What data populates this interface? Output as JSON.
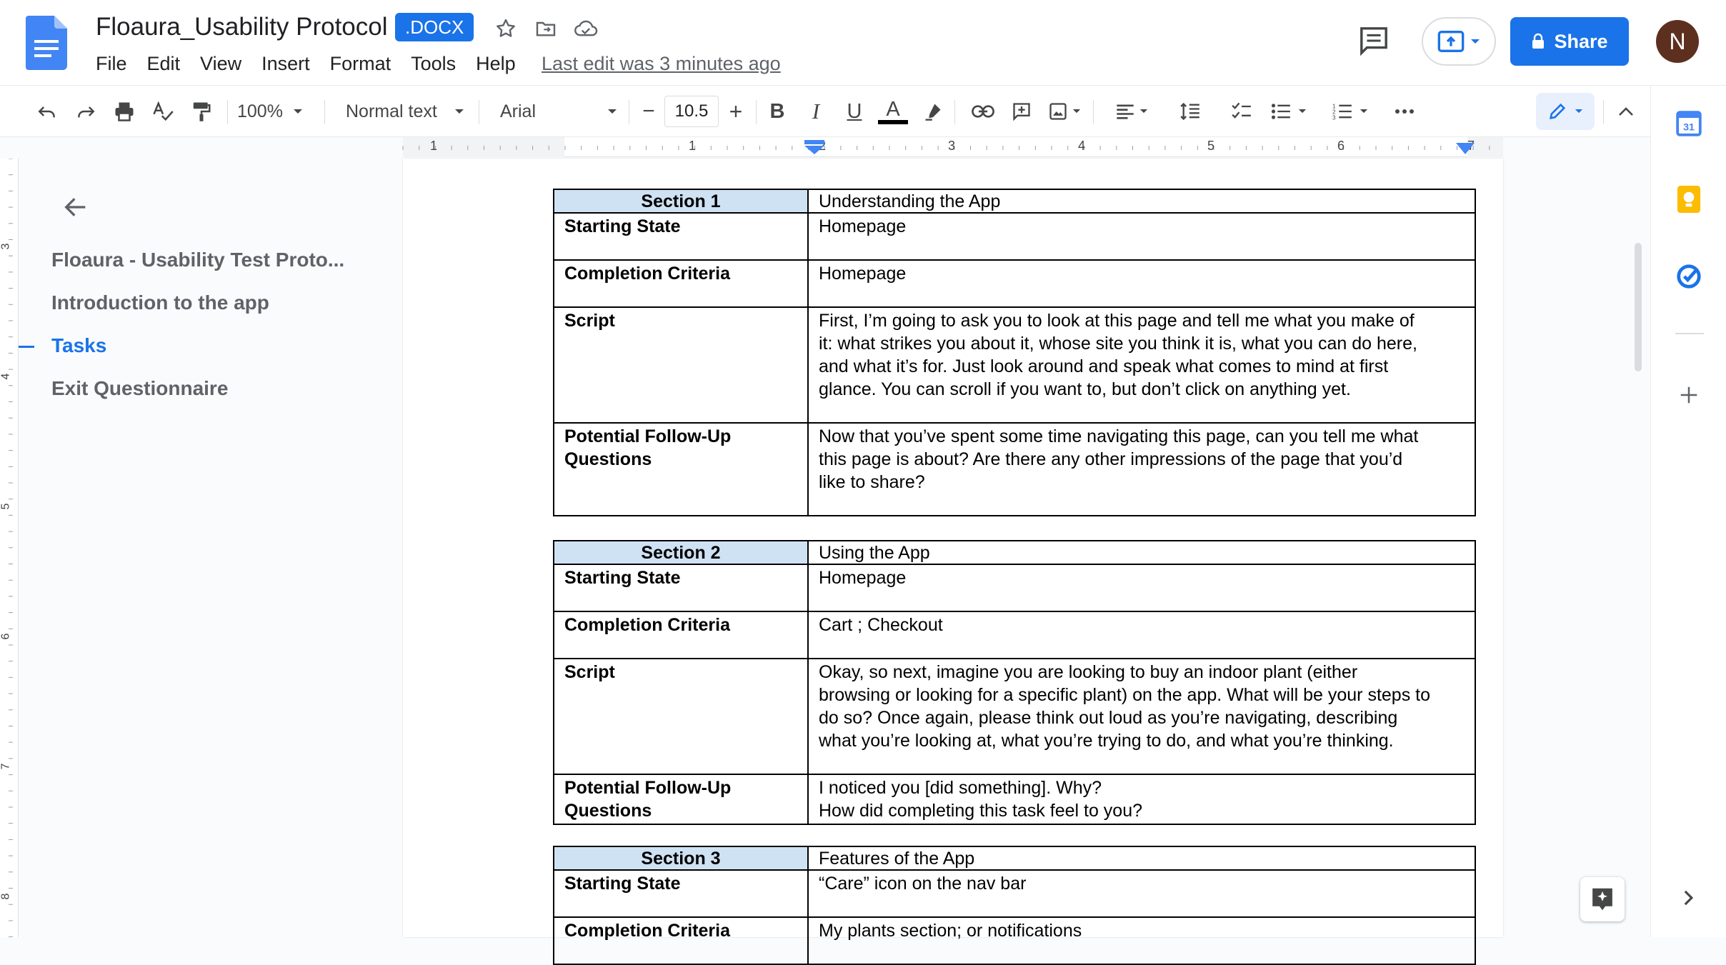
{
  "app": {
    "title": "Floaura_Usability Protocol",
    "badge": ".DOCX",
    "last_edit": "Last edit was 3 minutes ago",
    "share_label": "Share",
    "avatar_letter": "N",
    "accent_color": "#1a73e8"
  },
  "menu": [
    "File",
    "Edit",
    "View",
    "Insert",
    "Format",
    "Tools",
    "Help"
  ],
  "toolbar": {
    "zoom": "100%",
    "style": "Normal text",
    "font": "Arial",
    "font_size": "10.5",
    "bold": "B",
    "italic": "I",
    "underline": "U",
    "text_color": "A",
    "minus": "−",
    "plus": "+"
  },
  "ruler": {
    "h_numbers": [
      "1",
      "1",
      "2",
      "3",
      "4",
      "5",
      "6",
      "7"
    ],
    "v_numbers": [
      "3",
      "4",
      "5",
      "6",
      "7",
      "8"
    ]
  },
  "outline": {
    "items": [
      "Floaura - Usability Test Proto...",
      "Introduction to the app",
      "Tasks",
      "Exit Questionnaire"
    ],
    "active_index": 2
  },
  "sections": [
    {
      "header": "Section 1",
      "title": "Understanding the App",
      "rows": [
        {
          "label": "Starting State",
          "lines": [
            "Homepage"
          ]
        },
        {
          "label": "Completion Criteria",
          "lines": [
            "Homepage"
          ]
        },
        {
          "label": "Script",
          "lines": [
            "First, I’m going to ask you to look at this page and tell me what you make of",
            "it: what strikes you about it, whose site you think it is, what you can do here,",
            "and what it’s for. Just look around and speak what comes to mind at first",
            "glance. You can scroll if you want to, but don’t click on anything yet."
          ]
        },
        {
          "label_lines": [
            "Potential Follow-Up",
            "Questions"
          ],
          "lines": [
            "Now that you’ve spent some time navigating this page, can you tell me what",
            "this page is about? Are there any other impressions of the page that you’d",
            "like to share?"
          ]
        }
      ]
    },
    {
      "header": "Section 2",
      "title": "Using the App",
      "rows": [
        {
          "label": "Starting State",
          "lines": [
            "Homepage"
          ]
        },
        {
          "label": "Completion Criteria",
          "lines": [
            "Cart ; Checkout"
          ]
        },
        {
          "label": "Script",
          "lines": [
            "Okay, so next, imagine you are looking to buy an indoor plant (either",
            "browsing or looking for a specific plant) on the app. What will be your steps to",
            "do so? Once again, please think out loud as you’re navigating, describing",
            "what you’re looking at, what you’re trying to do, and what you’re thinking."
          ]
        },
        {
          "label_lines": [
            "Potential Follow-Up",
            "Questions"
          ],
          "lines": [
            "I noticed you [did something]. Why?",
            "How did completing this task feel to you?"
          ]
        }
      ]
    },
    {
      "header": "Section 3",
      "title": "Features of the App",
      "rows": [
        {
          "label": "Starting State",
          "lines": [
            "“Care” icon on the nav bar"
          ]
        },
        {
          "label": "Completion Criteria",
          "lines": [
            "My plants section; or notifications"
          ]
        }
      ]
    }
  ]
}
